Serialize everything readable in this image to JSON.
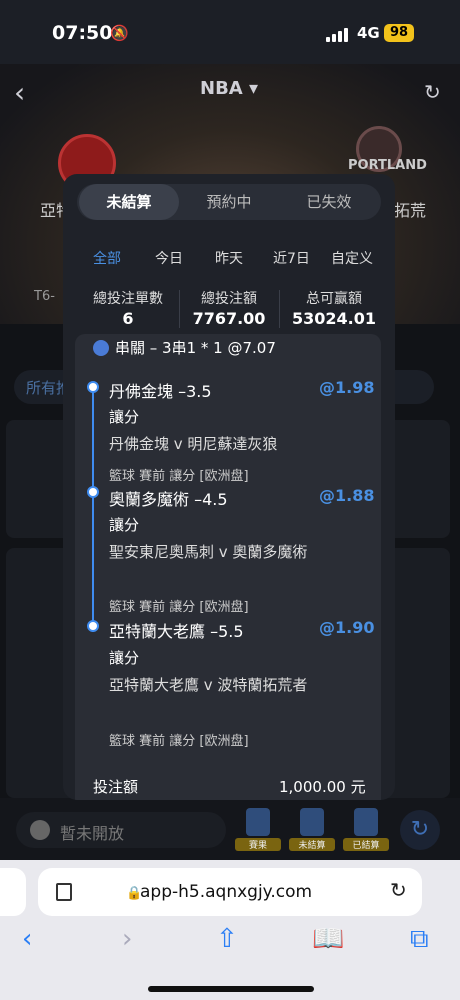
{
  "status_bar": {
    "time": "07:50",
    "network": "4G",
    "battery": "98"
  },
  "header": {
    "title": "NBA ▾"
  },
  "banner": {
    "team_left": "亞特",
    "team_right": "拓荒",
    "team_right_logo_text": "PORTLAND",
    "tag": "T6-"
  },
  "background": {
    "filter_label": "所有推",
    "closed_label": "暫未開放",
    "mini_buttons": [
      "賽果",
      "未結算",
      "已結算"
    ]
  },
  "modal": {
    "tabs": [
      "未結算",
      "預約中",
      "已失效"
    ],
    "active_tab": 0,
    "filters": [
      "全部",
      "今日",
      "昨天",
      "近7日",
      "自定义"
    ],
    "active_filter": 0,
    "stats": [
      {
        "label": "總投注單數",
        "value": "6"
      },
      {
        "label": "總投注額",
        "value": "7767.00"
      },
      {
        "label": "总可赢額",
        "value": "53024.01"
      }
    ],
    "parlay_title": "串關 – 3串1 * 1 @7.07",
    "legs": [
      {
        "title": "丹佛金塊 –3.5",
        "odds": "@1.98",
        "type": "讓分",
        "match": "丹佛金塊 v 明尼蘇達灰狼",
        "meta": "籃球  賽前  讓分 [欧洲盘]"
      },
      {
        "title": "奧蘭多魔術 –4.5",
        "odds": "@1.88",
        "type": "讓分",
        "match": "聖安東尼奧馬刺 v 奧蘭多魔術",
        "meta": "籃球  賽前  讓分 [欧洲盘]"
      },
      {
        "title": "亞特蘭大老鷹 –5.5",
        "odds": "@1.90",
        "type": "讓分",
        "match": "亞特蘭大老鷹 v 波特蘭拓荒者",
        "meta": "籃球  賽前  讓分 [欧洲盘]"
      }
    ],
    "stake_label": "投注額",
    "stake_value": "1,000.00 元"
  },
  "browser": {
    "url": "app-h5.aqnxgjy.com"
  }
}
